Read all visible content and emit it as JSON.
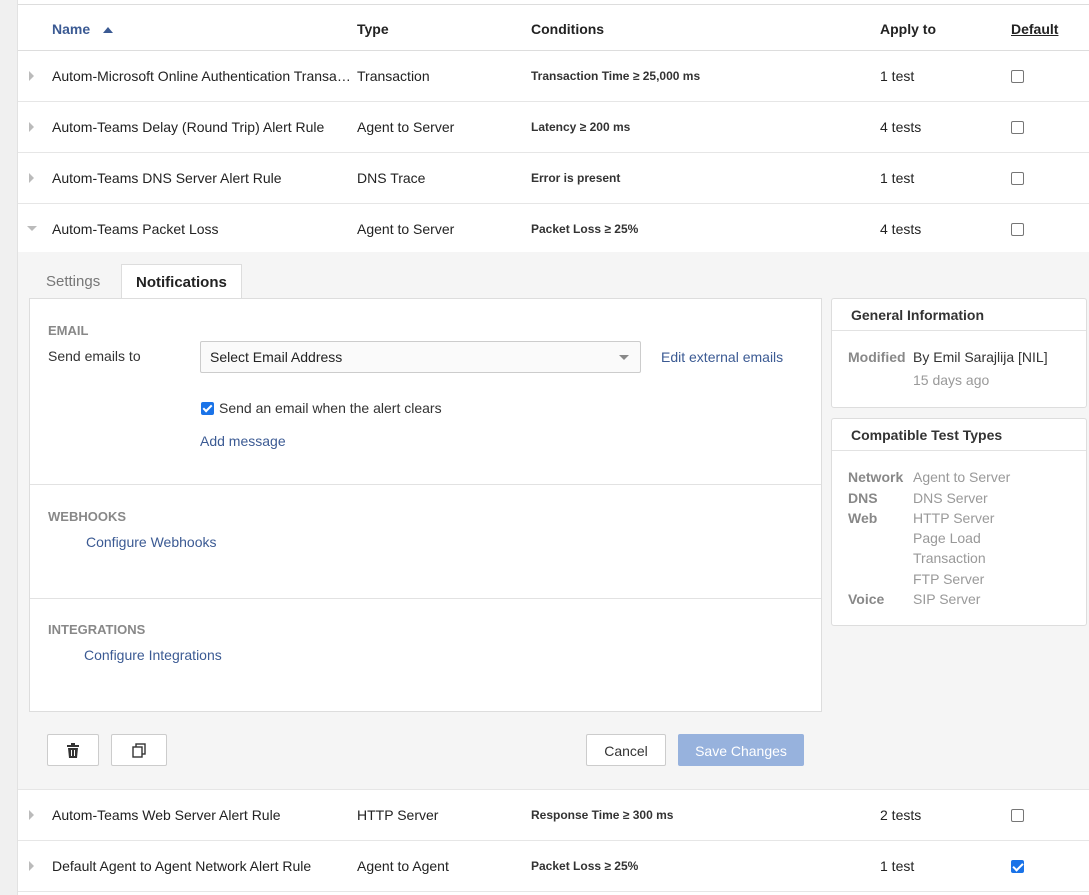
{
  "header": {
    "name": "Name",
    "type": "Type",
    "conditions": "Conditions",
    "apply_to": "Apply to",
    "default": "Default"
  },
  "rows_top": [
    {
      "name": "Autom-Microsoft Online Authentication Transaction Alert Rule",
      "type": "Transaction",
      "conditions": "Transaction Time ≥ 25,000 ms",
      "apply_to": "1 test",
      "default": false
    },
    {
      "name": "Autom-Teams Delay (Round Trip) Alert Rule",
      "type": "Agent to Server",
      "conditions": "Latency ≥ 200 ms",
      "apply_to": "4 tests",
      "default": false
    },
    {
      "name": "Autom-Teams DNS Server Alert Rule",
      "type": "DNS Trace",
      "conditions": "Error is present",
      "apply_to": "1 test",
      "default": false
    },
    {
      "name": "Autom-Teams Packet Loss",
      "type": "Agent to Server",
      "conditions": "Packet Loss ≥ 25%",
      "apply_to": "4 tests",
      "default": false
    }
  ],
  "tabs": {
    "settings": "Settings",
    "notifications": "Notifications"
  },
  "email": {
    "section": "EMAIL",
    "send_label": "Send emails to",
    "select_placeholder": "Select Email Address",
    "edit_external": "Edit external emails",
    "clears_label": "Send an email when the alert clears",
    "add_message": "Add message"
  },
  "webhooks": {
    "section": "WEBHOOKS",
    "configure": "Configure Webhooks"
  },
  "integrations": {
    "section": "INTEGRATIONS",
    "configure": "Configure Integrations"
  },
  "general_info": {
    "title": "General Information",
    "modified_label": "Modified",
    "modified_by": "By Emil Sarajlija [NIL]",
    "modified_when": "15 days ago"
  },
  "compat": {
    "title": "Compatible Test Types",
    "network_label": "Network",
    "network": "Agent to Server",
    "dns_label": "DNS",
    "dns": "DNS Server",
    "web_label": "Web",
    "web1": "HTTP Server",
    "web2": "Page Load",
    "web3": "Transaction",
    "web4": "FTP Server",
    "voice_label": "Voice",
    "voice": "SIP Server"
  },
  "actions": {
    "cancel": "Cancel",
    "save": "Save Changes"
  },
  "rows_bottom": [
    {
      "name": "Autom-Teams Web Server Alert Rule",
      "type": "HTTP Server",
      "conditions": "Response Time ≥ 300 ms",
      "apply_to": "2 tests",
      "default": false
    },
    {
      "name": "Default Agent to Agent Network Alert Rule",
      "type": "Agent to Agent",
      "conditions": "Packet Loss ≥ 25%",
      "apply_to": "1 test",
      "default": true
    }
  ],
  "colors": {
    "link": "#3b5a93",
    "save_disabled": "#97b2dd",
    "checkbox": "#1a73e8"
  }
}
